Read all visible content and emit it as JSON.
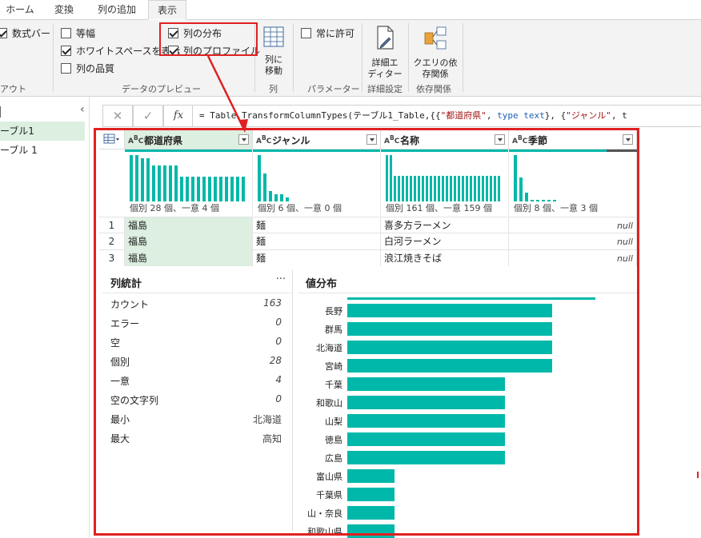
{
  "tabs": [
    "ホーム",
    "変換",
    "列の追加",
    "表示"
  ],
  "ribbon": {
    "formula_bar_label": "数式バー",
    "layout_group_label": "アウト",
    "preview": {
      "monospace": "等幅",
      "whitespace": "ホワイトスペースを表示",
      "quality": "列の品質",
      "distribution": "列の分布",
      "profile": "列のプロファイル",
      "group_label": "データのプレビュー"
    },
    "columns": {
      "goto_line1": "列に",
      "goto_line2": "移動",
      "group_label": "列"
    },
    "params": {
      "always_allow": "常に許可",
      "group_label": "パラメーター"
    },
    "advanced": {
      "line1": "詳細エ",
      "line2": "ディター",
      "group_label": "詳細設定"
    },
    "deps": {
      "line1": "クエリの依",
      "line2": "存関係",
      "group_label": "依存関係"
    }
  },
  "left_pane": {
    "items": [
      "ーブル1",
      "ーブル 1"
    ]
  },
  "formula": {
    "cancel": "✕",
    "confirm": "✓",
    "fx": "fx",
    "p1": "= Table.TransformColumnTypes(テーブル1_Table,{{",
    "p2": "\"都道府県\"",
    "p3": ", ",
    "p4": "type text",
    "p5": "}, {",
    "p6": "\"ジャンル\"",
    "p7": ", t"
  },
  "columns": [
    {
      "name": "都道府県",
      "profile": "個別 28 個、一意 4 個"
    },
    {
      "name": "ジャンル",
      "profile": "個別 6 個、一意 0 個"
    },
    {
      "name": "名称",
      "profile": "個別 161 個、一意 159 個"
    },
    {
      "name": "季節",
      "profile": "個別 8 個、一意 3 個"
    }
  ],
  "profile_distributions": [
    [
      1.0,
      1.0,
      0.93,
      0.93,
      0.77,
      0.77,
      0.77,
      0.77,
      0.77,
      0.54,
      0.54,
      0.54,
      0.54,
      0.54,
      0.54,
      0.54,
      0.54,
      0.54,
      0.54,
      0.54,
      0.54
    ],
    [
      1.0,
      0.61,
      0.23,
      0.15,
      0.15,
      0.08
    ],
    [
      1.0,
      1.0,
      0.56,
      0.56,
      0.56,
      0.56,
      0.56,
      0.56,
      0.56,
      0.56,
      0.56,
      0.56,
      0.56,
      0.56,
      0.56,
      0.56,
      0.56,
      0.56,
      0.56,
      0.56,
      0.56,
      0.56,
      0.56,
      0.56,
      0.56,
      0.56,
      0.56,
      0.56,
      0.56
    ],
    [
      1.0,
      0.52,
      0.19,
      0.04,
      0.04,
      0.04,
      0.04,
      0.04
    ]
  ],
  "rows": [
    {
      "n": "1",
      "pref": "福島",
      "genre": "麺",
      "name": "喜多方ラーメン",
      "season": "null"
    },
    {
      "n": "2",
      "pref": "福島",
      "genre": "麺",
      "name": "白河ラーメン",
      "season": "null"
    },
    {
      "n": "3",
      "pref": "福島",
      "genre": "麺",
      "name": "浪江焼きそば",
      "season": "null"
    }
  ],
  "stats": {
    "title": "列統計",
    "more": "···",
    "items": [
      {
        "k": "カウント",
        "v": "163",
        "it": true
      },
      {
        "k": "エラー",
        "v": "0",
        "it": true
      },
      {
        "k": "空",
        "v": "0",
        "it": true
      },
      {
        "k": "個別",
        "v": "28",
        "it": true
      },
      {
        "k": "一意",
        "v": "4",
        "it": true
      },
      {
        "k": "空の文字列",
        "v": "0",
        "it": true
      },
      {
        "k": "最小",
        "v": "北海道",
        "it": false
      },
      {
        "k": "最大",
        "v": "高知",
        "it": false
      }
    ]
  },
  "distribution": {
    "title": "値分布",
    "items": [
      {
        "label": "長野",
        "value": 13
      },
      {
        "label": "群馬",
        "value": 13
      },
      {
        "label": "北海道",
        "value": 13
      },
      {
        "label": "宮崎",
        "value": 13
      },
      {
        "label": "千葉",
        "value": 10
      },
      {
        "label": "和歌山",
        "value": 10
      },
      {
        "label": "山梨",
        "value": 10
      },
      {
        "label": "徳島",
        "value": 10
      },
      {
        "label": "広島",
        "value": 10
      },
      {
        "label": "富山県",
        "value": 3
      },
      {
        "label": "千葉県",
        "value": 3
      },
      {
        "label": "山・奈良",
        "value": 3
      },
      {
        "label": "和歌山県",
        "value": 3
      }
    ],
    "max": 13
  },
  "colors": {
    "accent": "#00b8a9",
    "selected": "#dcefe0",
    "annotation": "#e02020"
  }
}
